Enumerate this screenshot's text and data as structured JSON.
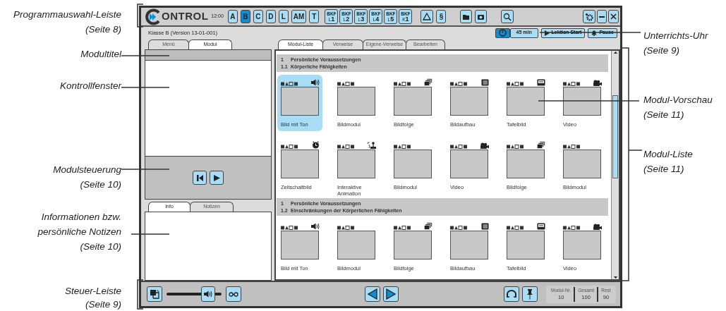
{
  "annotations": [
    {
      "lines": [
        "Programmauswahl-Leiste",
        "(Seite 8)"
      ]
    },
    {
      "lines": [
        "Modultitel"
      ]
    },
    {
      "lines": [
        "Kontrollfenster"
      ]
    },
    {
      "lines": [
        "Modulsteuerung",
        "(Seite 10)"
      ]
    },
    {
      "lines": [
        "Informationen bzw.",
        "persönliche Notizen",
        "(Seite 10)"
      ]
    },
    {
      "lines": [
        "Steuer-Leiste",
        "(Seite 9)"
      ]
    },
    {
      "lines": [
        "Unterrichts-Uhr",
        "(Seite 9)"
      ]
    },
    {
      "lines": [
        "Modul-Vorschau",
        "(Seite 11)"
      ]
    },
    {
      "lines": [
        "Modul-Liste",
        "(Seite 11)"
      ]
    }
  ],
  "toolbar": {
    "logo": "ONTROL",
    "time": "12:00",
    "programs": [
      {
        "label": "A",
        "selected": false
      },
      {
        "label": "B",
        "selected": true
      },
      {
        "label": "C",
        "selected": false
      },
      {
        "label": "D",
        "selected": false
      },
      {
        "label": "L",
        "selected": false
      },
      {
        "label": "AM",
        "selected": false
      },
      {
        "label": "T",
        "selected": false
      }
    ],
    "bkf": [
      {
        "top": "BKF",
        "sub": "L",
        "num": "1"
      },
      {
        "top": "BKF",
        "sub": "L",
        "num": "2"
      },
      {
        "top": "BKF",
        "sub": "L",
        "num": "3"
      },
      {
        "top": "BKF",
        "sub": "L",
        "num": "4"
      },
      {
        "top": "BKF",
        "sub": "L",
        "num": "5"
      },
      {
        "top": "BKF",
        "sub": "K",
        "num": "1"
      }
    ],
    "paragraph": "§"
  },
  "header": {
    "class_label": "Klasse B (Version 13-01-001)",
    "timer": "45 min",
    "start": "Lektion Start",
    "pause": "Pause"
  },
  "left_tabs": [
    {
      "label": "Menü",
      "selected": false
    },
    {
      "label": "Modul",
      "selected": true
    }
  ],
  "info_tabs": [
    {
      "label": "Info",
      "selected": true
    },
    {
      "label": "Notizen",
      "selected": false
    }
  ],
  "list_tabs": [
    {
      "label": "Modul-Liste",
      "selected": true
    },
    {
      "label": "Verweise",
      "selected": false
    },
    {
      "label": "Eigene-Verweise",
      "selected": false
    },
    {
      "label": "Bearbeiten",
      "selected": false
    }
  ],
  "sections": [
    {
      "heading": [
        {
          "num": "1",
          "title": "Persönliche Voraussetzungen"
        },
        {
          "num": "1.1",
          "title": "Körperliche Fähigkeiten"
        }
      ],
      "modules": [
        {
          "label": "Bild mit Ton",
          "kind": "audio",
          "selected": true
        },
        {
          "label": "Bildmodul",
          "kind": "image",
          "selected": false
        },
        {
          "label": "Bildfolge",
          "kind": "sequence",
          "selected": false
        },
        {
          "label": "Bildaufbau",
          "kind": "buildup",
          "selected": false
        },
        {
          "label": "Tafelbild",
          "kind": "board",
          "selected": false
        },
        {
          "label": "Video",
          "kind": "video",
          "selected": false
        },
        {
          "label": "Zeitschaltbild",
          "kind": "timed",
          "selected": false
        },
        {
          "label": "Interaktive Animation",
          "kind": "interactive",
          "selected": false
        },
        {
          "label": "Bildmodul",
          "kind": "image",
          "selected": false
        },
        {
          "label": "Video",
          "kind": "video",
          "selected": false
        },
        {
          "label": "Bildfolge",
          "kind": "sequence",
          "selected": false
        },
        {
          "label": "Bildmodul",
          "kind": "image",
          "selected": false
        }
      ]
    },
    {
      "heading": [
        {
          "num": "1",
          "title": "Persönliche Voraussetzungen"
        },
        {
          "num": "1.2",
          "title": "Einschränkungen der Körperlichen Fähigkeiten"
        }
      ],
      "modules": [
        {
          "label": "Bild mit Ton",
          "kind": "audio",
          "selected": false
        },
        {
          "label": "Bildmodul",
          "kind": "image",
          "selected": false
        },
        {
          "label": "Bildfolge",
          "kind": "sequence",
          "selected": false
        },
        {
          "label": "Bildaufbau",
          "kind": "buildup",
          "selected": false
        },
        {
          "label": "Tafelbild",
          "kind": "board",
          "selected": false
        },
        {
          "label": "Video",
          "kind": "video",
          "selected": false
        }
      ]
    }
  ],
  "controls": {
    "volume": {
      "level": 0.75
    },
    "counters": [
      {
        "label": "Modul-Nr.",
        "value": "10"
      },
      {
        "label": "Gesamt",
        "value": "100"
      },
      {
        "label": "Rest",
        "value": "90"
      }
    ]
  }
}
